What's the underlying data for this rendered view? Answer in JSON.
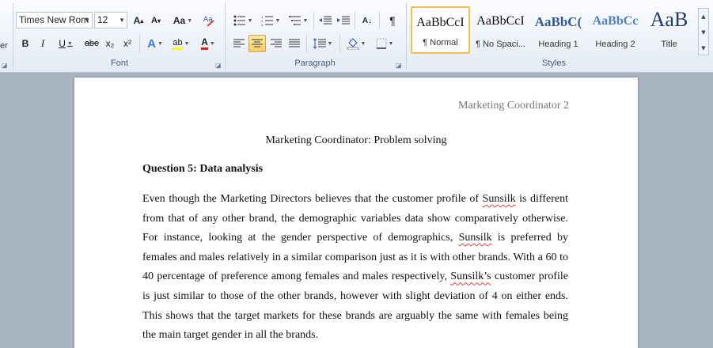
{
  "ribbon": {
    "left_cut_text": "er",
    "font": {
      "label": "Font",
      "font_name": "Times New Rom",
      "font_size": "12",
      "grow_label": "A",
      "shrink_label": "A",
      "change_case_label": "Aa",
      "bold_label": "B",
      "italic_label": "I",
      "underline_label": "U",
      "strike_label": "abe",
      "subscript_label": "x₂",
      "superscript_label": "x²",
      "text_effects_label": "A",
      "highlight_label": "ab",
      "font_color_label": "A",
      "colors": {
        "highlight": "#ffff00",
        "font_color": "#e81b1b"
      }
    },
    "paragraph": {
      "label": "Paragraph",
      "sort_label": "A↓",
      "pilcrow_label": "¶"
    },
    "styles": {
      "label": "Styles",
      "items": [
        {
          "sample": "AaBbCcI",
          "name": "¶ Normal"
        },
        {
          "sample": "AaBbCcI",
          "name": "¶ No Spaci..."
        },
        {
          "sample": "AaBbC(",
          "name": "Heading 1"
        },
        {
          "sample": "AaBbCc",
          "name": "Heading 2"
        },
        {
          "sample": "AaB",
          "name": "Title"
        }
      ]
    }
  },
  "document": {
    "header": "Marketing Coordinator 2",
    "title": "Marketing Coordinator: Problem solving",
    "question_heading": "Question 5: Data analysis",
    "paragraph": [
      {
        "text": "Even though the Marketing Directors believes that the customer profile of "
      },
      {
        "text": "Sunsilk",
        "spell": true
      },
      {
        "text": " is different from that of any other brand, the demographic variables data show comparatively otherwise. For instance, looking at the gender perspective of demographics, "
      },
      {
        "text": "Sunsilk",
        "spell": true
      },
      {
        "text": " is preferred by females and males relatively in a similar comparison just as it is with other brands. With a 60 to 40 percentage of preference among females and males respectively, "
      },
      {
        "text": "Sunsilk’s",
        "spell": true
      },
      {
        "text": " customer profile is just similar to those of the other brands, however with slight deviation of 4 on either ends. This shows that the target markets for these brands are arguably the same with females being the main target gender in all the brands."
      }
    ]
  }
}
